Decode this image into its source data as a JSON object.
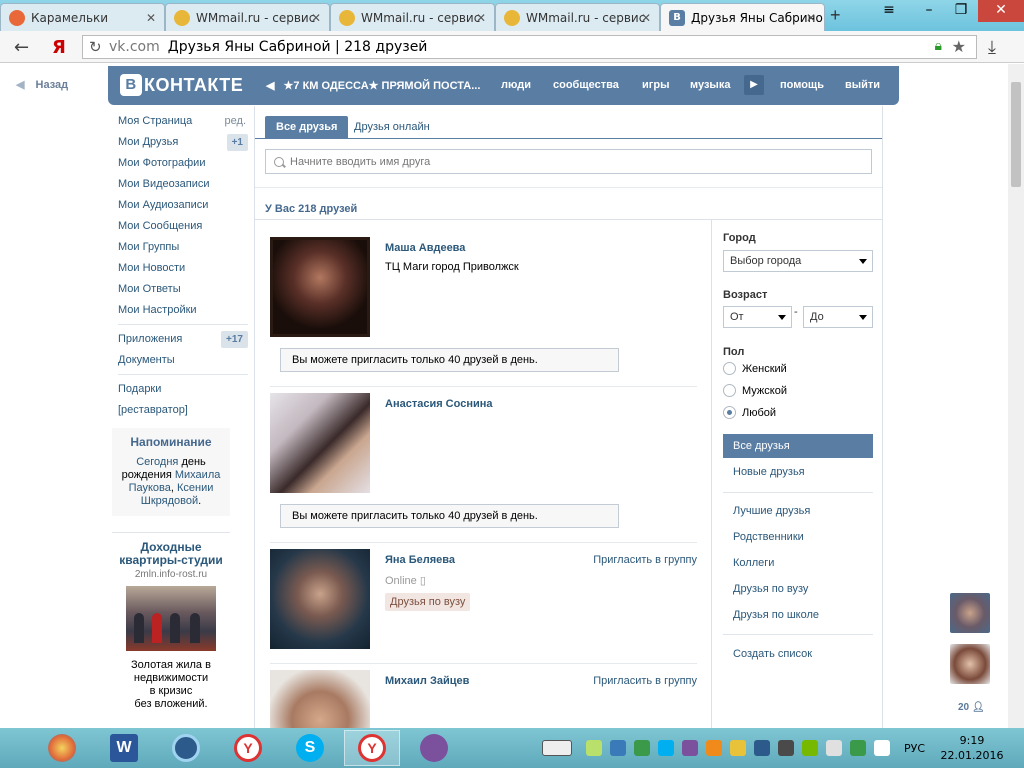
{
  "browser": {
    "tabs": [
      {
        "label": "Карамельки"
      },
      {
        "label": "WMmail.ru - сервис"
      },
      {
        "label": "WMmail.ru - сервис"
      },
      {
        "label": "WMmail.ru - сервис"
      },
      {
        "label": "Друзья Яны Сабрино"
      }
    ],
    "new_tab": "+",
    "address_domain": "vk.com",
    "address_title": "Друзья Яны Сабриной | 218 друзей"
  },
  "header": {
    "back": "Назад",
    "logo_letter": "В",
    "logo_text": "КОНТАКТЕ",
    "ticker": "★7 КМ ОДЕССА★ ПРЯМОЙ ПОСТА...",
    "nav": [
      "люди",
      "сообщества",
      "игры",
      "музыка",
      "помощь",
      "выйти"
    ]
  },
  "left_menu": {
    "items": [
      {
        "label": "Моя Страница",
        "right": "ред."
      },
      {
        "label": "Мои Друзья",
        "badge": "+1"
      },
      {
        "label": "Мои Фотографии"
      },
      {
        "label": "Мои Видеозаписи"
      },
      {
        "label": "Мои Аудиозаписи"
      },
      {
        "label": "Мои Сообщения"
      },
      {
        "label": "Мои Группы"
      },
      {
        "label": "Мои Новости"
      },
      {
        "label": "Мои Ответы"
      },
      {
        "label": "Мои Настройки"
      }
    ],
    "items2": [
      {
        "label": "Приложения",
        "badge": "+17"
      },
      {
        "label": "Документы"
      }
    ],
    "items3": [
      {
        "label": "Подарки"
      },
      {
        "label": "[реставратор]"
      }
    ]
  },
  "reminder": {
    "title": "Напоминание",
    "today": "Сегодня",
    "day": "день",
    "birthday": "рождения",
    "n1": "Михаила",
    "n2": "Паукова",
    "and": ", ",
    "n3": "Ксении",
    "n4": "Шкрядовой",
    "dot": "."
  },
  "ad": {
    "title": "Доходные квартиры-студии",
    "domain": "2mln.info-rost.ru",
    "text_lines": [
      "Золотая жила в",
      "недвижимости",
      "в кризис",
      "без вложений."
    ]
  },
  "main": {
    "tabs": [
      "Все друзья",
      "Друзья онлайн"
    ],
    "search_placeholder": "Начните вводить имя друга",
    "count": "У Вас 218 друзей"
  },
  "friends": [
    {
      "name": "Маша Авдеева",
      "sub": "ТЦ Маги город Приволжск",
      "note": "Вы можете пригласить только 40 друзей в день."
    },
    {
      "name": "Анастасия Соснина",
      "note": "Вы можете пригласить только 40 друзей в день."
    },
    {
      "name": "Яна Беляева",
      "online": "Online",
      "tag": "Друзья по вузу",
      "invite": "Пригласить в группу"
    },
    {
      "name": "Михаил Зайцев",
      "invite": "Пригласить в группу"
    }
  ],
  "filters": {
    "city_label": "Город",
    "city_value": "Выбор города",
    "age_label": "Возраст",
    "age_from": "От",
    "age_dash": "-",
    "age_to": "До",
    "sex_label": "Пол",
    "sex_options": [
      "Женский",
      "Мужской",
      "Любой"
    ],
    "sex_selected": "Любой",
    "links_a": [
      "Все друзья",
      "Новые друзья"
    ],
    "links_b": [
      "Лучшие друзья",
      "Родственники",
      "Коллеги",
      "Друзья по вузу",
      "Друзья по школе"
    ],
    "create_list": "Создать список"
  },
  "side": {
    "online_count": "20"
  },
  "taskbar": {
    "lang": "РУС",
    "time": "9:19",
    "date": "22.01.2016"
  },
  "colors": {
    "accent": "#597da3",
    "link": "#2b587a"
  }
}
